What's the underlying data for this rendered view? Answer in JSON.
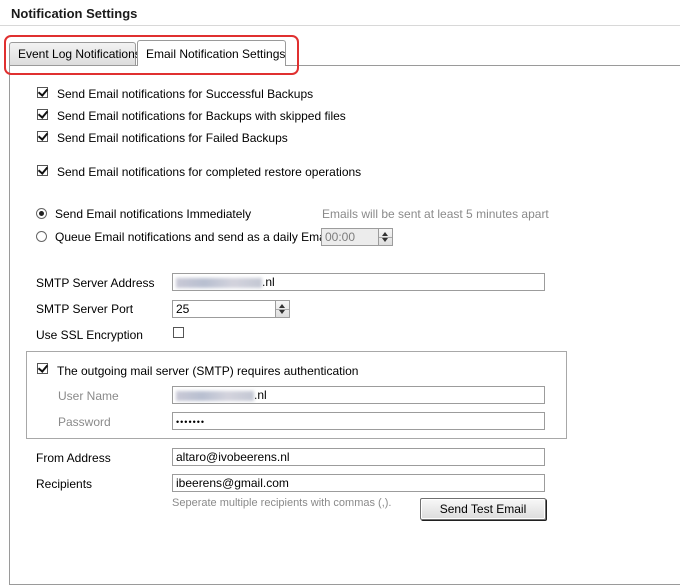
{
  "header": {
    "title": "Notification Settings"
  },
  "tabs": [
    {
      "label": "Event Log Notifications",
      "active": false
    },
    {
      "label": "Email Notification Settings",
      "active": true
    }
  ],
  "notifications": {
    "successful": {
      "label": "Send Email notifications for Successful Backups",
      "checked": true
    },
    "skipped": {
      "label": "Send Email notifications for Backups with skipped files",
      "checked": true
    },
    "failed": {
      "label": "Send Email notifications for Failed Backups",
      "checked": true
    },
    "restore": {
      "label": "Send Email notifications for completed restore operations",
      "checked": true
    }
  },
  "schedule": {
    "immediate_label": "Send Email notifications Immediately",
    "immediate_note": "Emails will be sent at least 5 minutes apart",
    "daily_label": "Queue Email notifications and send as a daily Email at",
    "daily_time": "00:00",
    "selected": "immediate"
  },
  "smtp": {
    "server_label": "SMTP Server Address",
    "server_value_suffix": ".nl",
    "port_label": "SMTP Server Port",
    "port_value": "25",
    "ssl_label": "Use SSL Encryption",
    "ssl_checked": false
  },
  "auth": {
    "label": "The outgoing mail server (SMTP) requires authentication",
    "checked": true,
    "username_label": "User Name",
    "username_value_suffix": ".nl",
    "password_label": "Password",
    "password_value": "•••••••"
  },
  "email": {
    "from_label": "From Address",
    "from_value": "altaro@ivobeerens.nl",
    "recipients_label": "Recipients",
    "recipients_value": "ibeerens@gmail.com",
    "recipients_hint": "Seperate multiple recipients with commas (,).",
    "test_button": "Send Test Email"
  }
}
